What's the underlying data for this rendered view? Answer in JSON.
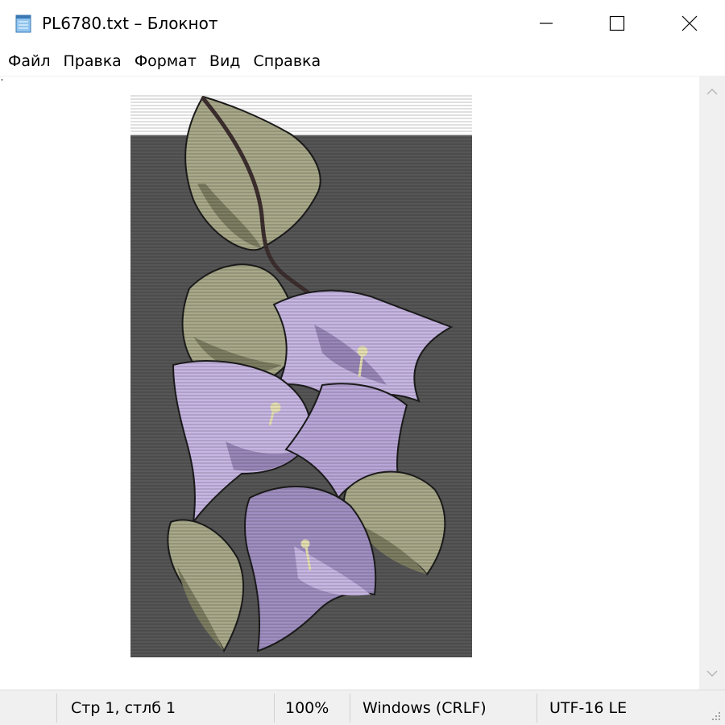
{
  "window": {
    "title": "PL6780.txt – Блокнот",
    "icon": "notepad-icon",
    "controls": [
      "minimize-icon",
      "maximize-icon",
      "close-icon"
    ]
  },
  "menu": {
    "items": [
      "Файл",
      "Правка",
      "Формат",
      "Вид",
      "Справка"
    ]
  },
  "editor": {
    "content_picture": "bougainvillea-illustration",
    "colors": {
      "background": "#565656",
      "leaf": "#a9a98a",
      "leaf_dark": "#7d7d62",
      "flower": "#c7b6e3",
      "flower_dark": "#9a87b9",
      "stem": "#3e2f2f",
      "outline": "#1c1c1c"
    }
  },
  "scrollbar": {
    "up_icon": "chevron-up-icon",
    "down_icon": "chevron-down-icon"
  },
  "status": {
    "position": "Стр 1, стлб 1",
    "zoom": "100%",
    "line_endings": "Windows (CRLF)",
    "encoding": "UTF-16 LE"
  }
}
